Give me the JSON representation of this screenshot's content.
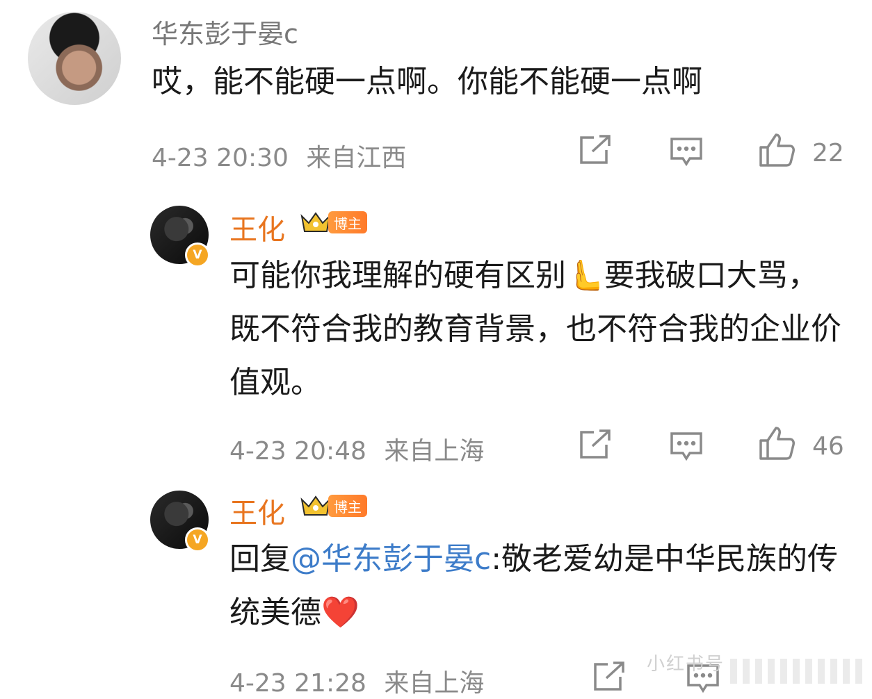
{
  "comment": {
    "username": "华东彭于晏c",
    "text": "哎，能不能硬一点啊。你能不能硬一点啊",
    "date": "4-23 20:30",
    "location": "来自江西",
    "likes": "22"
  },
  "replies": [
    {
      "username": "王化",
      "badge": "博主",
      "text": "可能你我理解的硬有区别🫷要我破口大骂，既不符合我的教育背景，也不符合我的企业价值观。",
      "date": "4-23 20:48",
      "location": "来自上海",
      "likes": "46"
    },
    {
      "username": "王化",
      "badge": "博主",
      "reply_prefix": "回复",
      "mention": "@华东彭于晏c",
      "text": ":敬老爱幼是中华民族的传统美德❤️",
      "date": "4-23 21:28",
      "location": "来自上海"
    }
  ],
  "watermark": "小红书号",
  "colors": {
    "blogger_name": "#e8751f",
    "mention": "#3d7cc9",
    "meta": "#8a8a8a"
  },
  "icons": [
    "share-icon",
    "comment-icon",
    "like-icon",
    "crown-icon",
    "verified-icon"
  ]
}
